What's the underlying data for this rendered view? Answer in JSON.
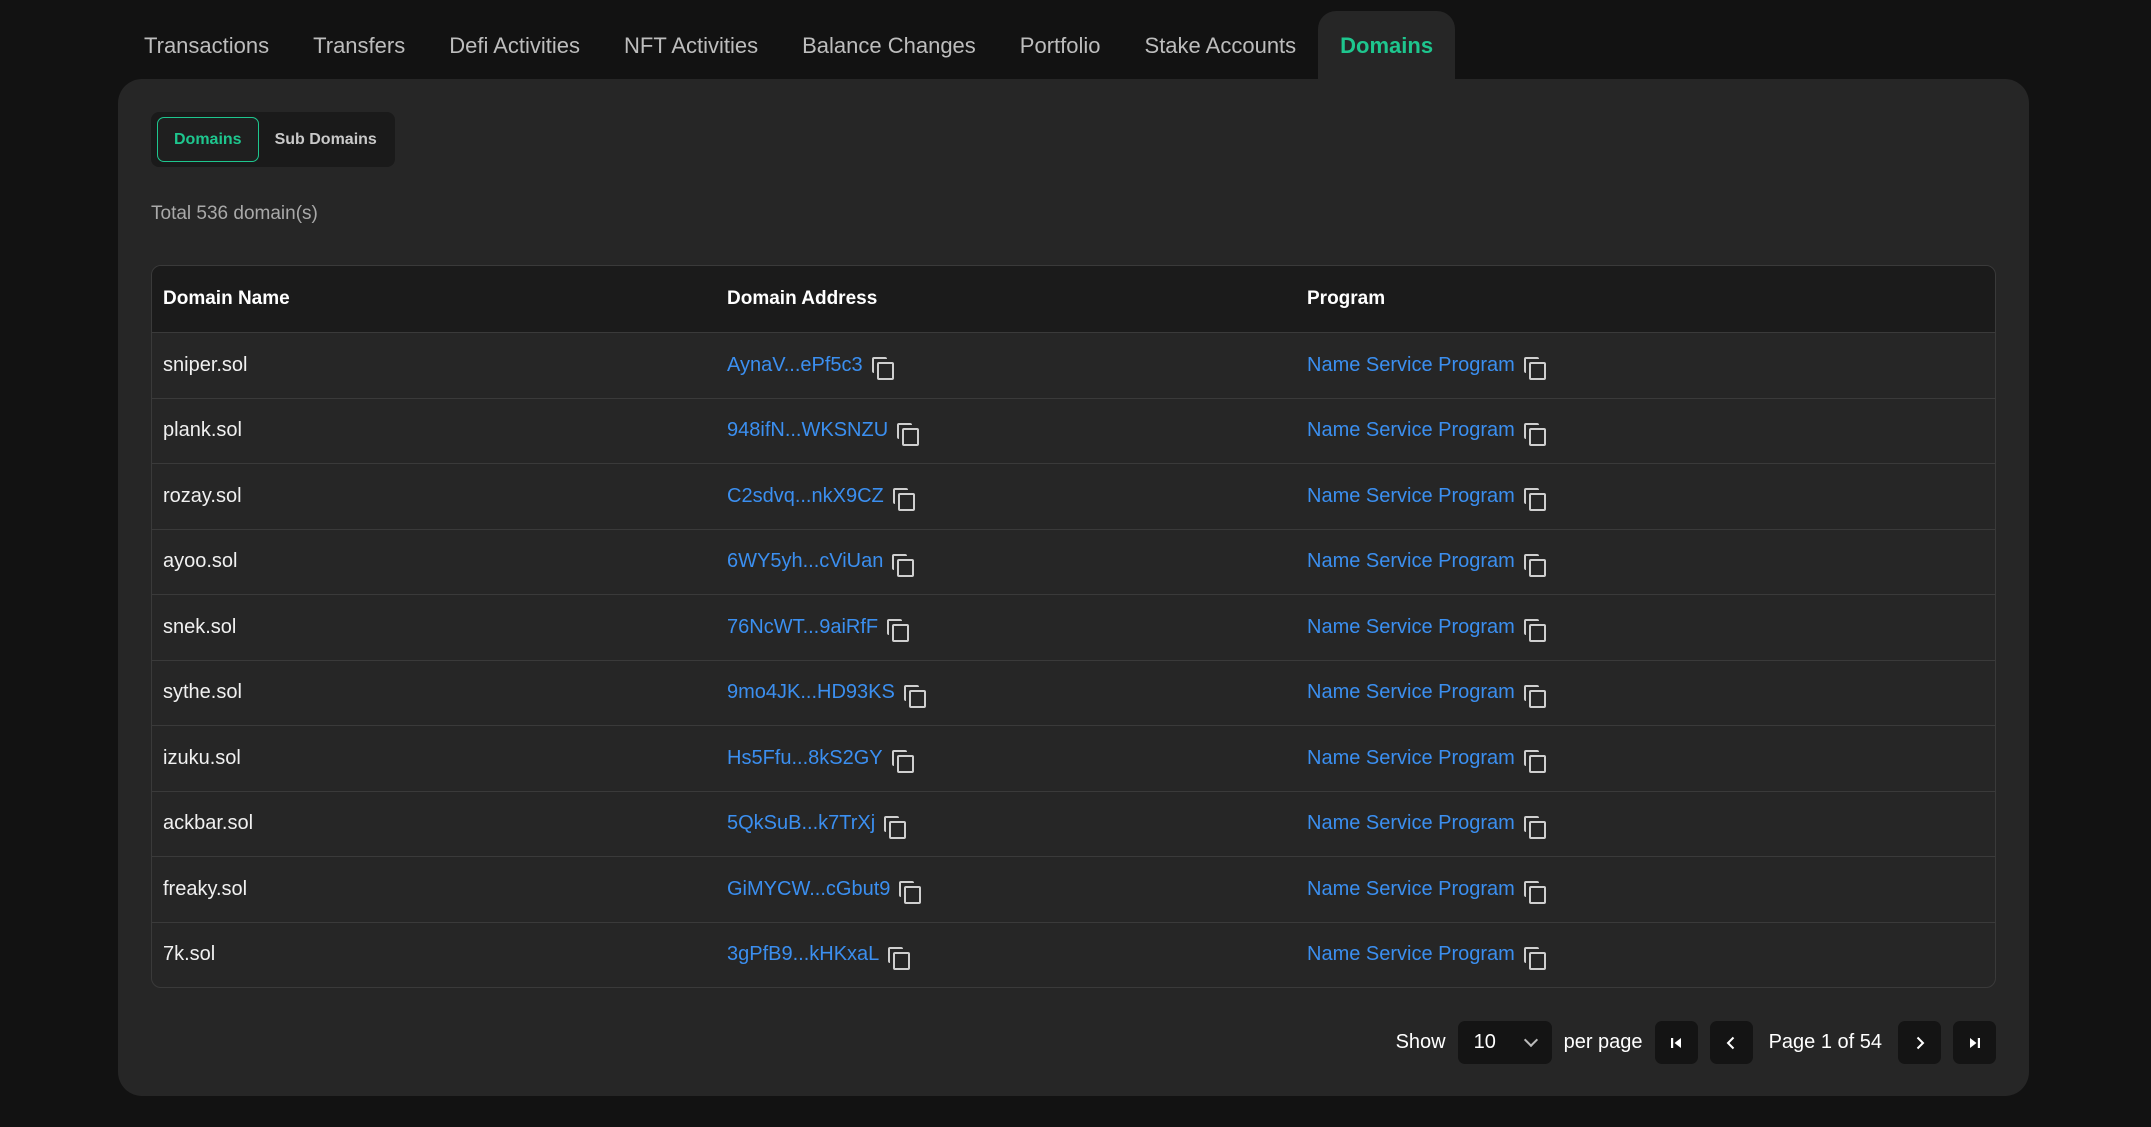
{
  "tabs": [
    {
      "label": "Transactions"
    },
    {
      "label": "Transfers"
    },
    {
      "label": "Defi Activities"
    },
    {
      "label": "NFT Activities"
    },
    {
      "label": "Balance Changes"
    },
    {
      "label": "Portfolio"
    },
    {
      "label": "Stake Accounts"
    },
    {
      "label": "Domains",
      "active": true
    }
  ],
  "subtabs": [
    {
      "label": "Domains",
      "active": true
    },
    {
      "label": "Sub Domains"
    }
  ],
  "total_text": "Total 536 domain(s)",
  "table": {
    "headers": [
      "Domain Name",
      "Domain Address",
      "Program"
    ],
    "rows": [
      {
        "name": "sniper.sol",
        "address": "AynaV...ePf5c3",
        "program": "Name Service Program"
      },
      {
        "name": "plank.sol",
        "address": "948ifN...WKSNZU",
        "program": "Name Service Program"
      },
      {
        "name": "rozay.sol",
        "address": "C2sdvq...nkX9CZ",
        "program": "Name Service Program"
      },
      {
        "name": "ayoo.sol",
        "address": "6WY5yh...cViUan",
        "program": "Name Service Program"
      },
      {
        "name": "snek.sol",
        "address": "76NcWT...9aiRfF",
        "program": "Name Service Program"
      },
      {
        "name": "sythe.sol",
        "address": "9mo4JK...HD93KS",
        "program": "Name Service Program"
      },
      {
        "name": "izuku.sol",
        "address": "Hs5Ffu...8kS2GY",
        "program": "Name Service Program"
      },
      {
        "name": "ackbar.sol",
        "address": "5QkSuB...k7TrXj",
        "program": "Name Service Program"
      },
      {
        "name": "freaky.sol",
        "address": "GiMYCW...cGbut9",
        "program": "Name Service Program"
      },
      {
        "name": "7k.sol",
        "address": "3gPfB9...kHKxaL",
        "program": "Name Service Program"
      }
    ]
  },
  "pagination": {
    "show_label": "Show",
    "per_page_value": "10",
    "per_page_label": "per page",
    "page_text": "Page 1 of 54"
  },
  "colors": {
    "accent": "#1ec68e",
    "link": "#3b8ff0",
    "panel": "#262626",
    "background": "#121212"
  },
  "icons": [
    "copy-icon",
    "chevron-down-icon",
    "first-page-icon",
    "prev-page-icon",
    "next-page-icon",
    "last-page-icon"
  ]
}
